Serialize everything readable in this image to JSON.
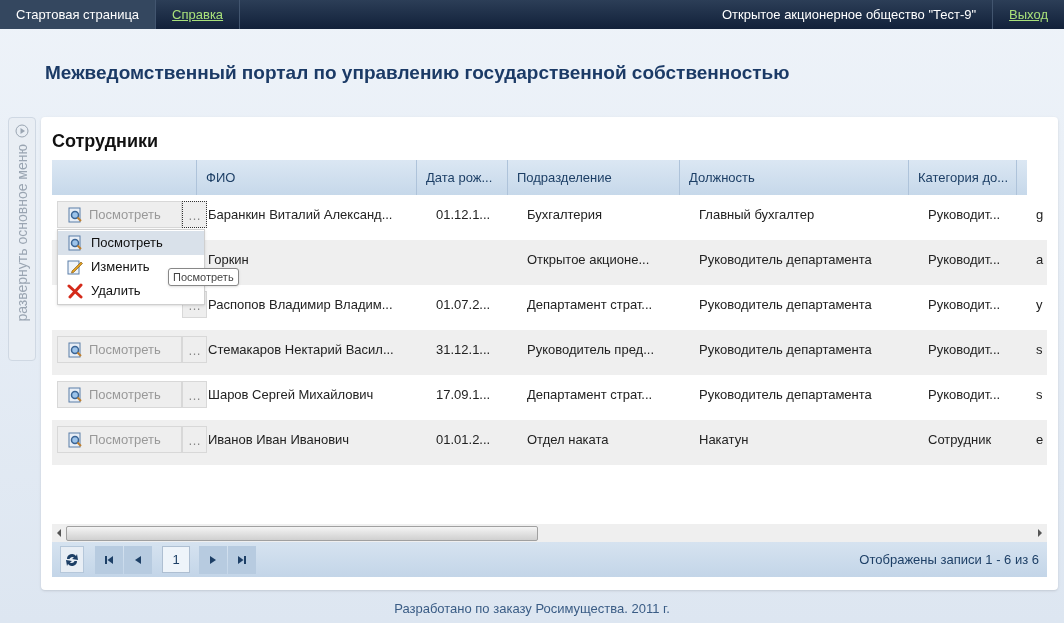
{
  "top_bar": {
    "links": [
      {
        "label": "Стартовая страница",
        "selected": true
      },
      {
        "label": "Справка",
        "selected": false
      }
    ],
    "organization": "Открытое акционерное общество \"Тест-9\"",
    "logout": "Выход"
  },
  "portal_title": "Межведомственный портал по управлению государственной собственностью",
  "sidebar": {
    "label": "развернуть основное меню"
  },
  "panel": {
    "title": "Сотрудники",
    "columns": [
      "ФИО",
      "Дата рож...",
      "Подразделение",
      "Должность",
      "Категория до..."
    ],
    "rows": [
      {
        "view_button": "Посмотреть",
        "more": "…",
        "focused": true,
        "cells": [
          "Баранкин Виталий Александ...",
          "01.12.1...",
          "Бухгалтерия",
          "Главный бухгалтер",
          "Руководит...",
          "g"
        ]
      },
      {
        "cells": [
          "Горкин",
          "",
          "Открытое акционе...",
          "Руководитель департамента",
          "Руководит...",
          "a"
        ]
      },
      {
        "more": "…",
        "focused": false,
        "cells": [
          "Распопов Владимир Владим...",
          "01.07.2...",
          "Департамент страт...",
          "Руководитель департамента",
          "Руководит...",
          "y"
        ]
      },
      {
        "view_button": "Посмотреть",
        "more": "…",
        "focused": false,
        "cells": [
          "Стемакаров Нектарий Васил...",
          "31.12.1...",
          "Руководитель пред...",
          "Руководитель департамента",
          "Руководит...",
          "s"
        ]
      },
      {
        "view_button": "Посмотреть",
        "more": "…",
        "focused": false,
        "cells": [
          "Шаров Сергей Михайлович",
          "17.09.1...",
          "Департамент страт...",
          "Руководитель департамента",
          "Руководит...",
          "s"
        ]
      },
      {
        "view_button": "Посмотреть",
        "more": "…",
        "focused": false,
        "cells": [
          "Иванов Иван Иванович",
          "01.01.2...",
          "Отдел наката",
          "Накатун",
          "Сотрудник",
          "e"
        ]
      }
    ],
    "context_menu": [
      {
        "kind": "view",
        "label": "Посмотреть",
        "selected": true
      },
      {
        "kind": "edit",
        "label": "Изменить",
        "selected": false
      },
      {
        "kind": "delete",
        "label": "Удалить",
        "selected": false
      }
    ],
    "tooltip": "Посмотреть",
    "pager": {
      "page": "1",
      "summary": "Отображены записи 1 - 6 из 6"
    }
  },
  "footer": "Разработано по заказу Росимущества. 2011 г."
}
